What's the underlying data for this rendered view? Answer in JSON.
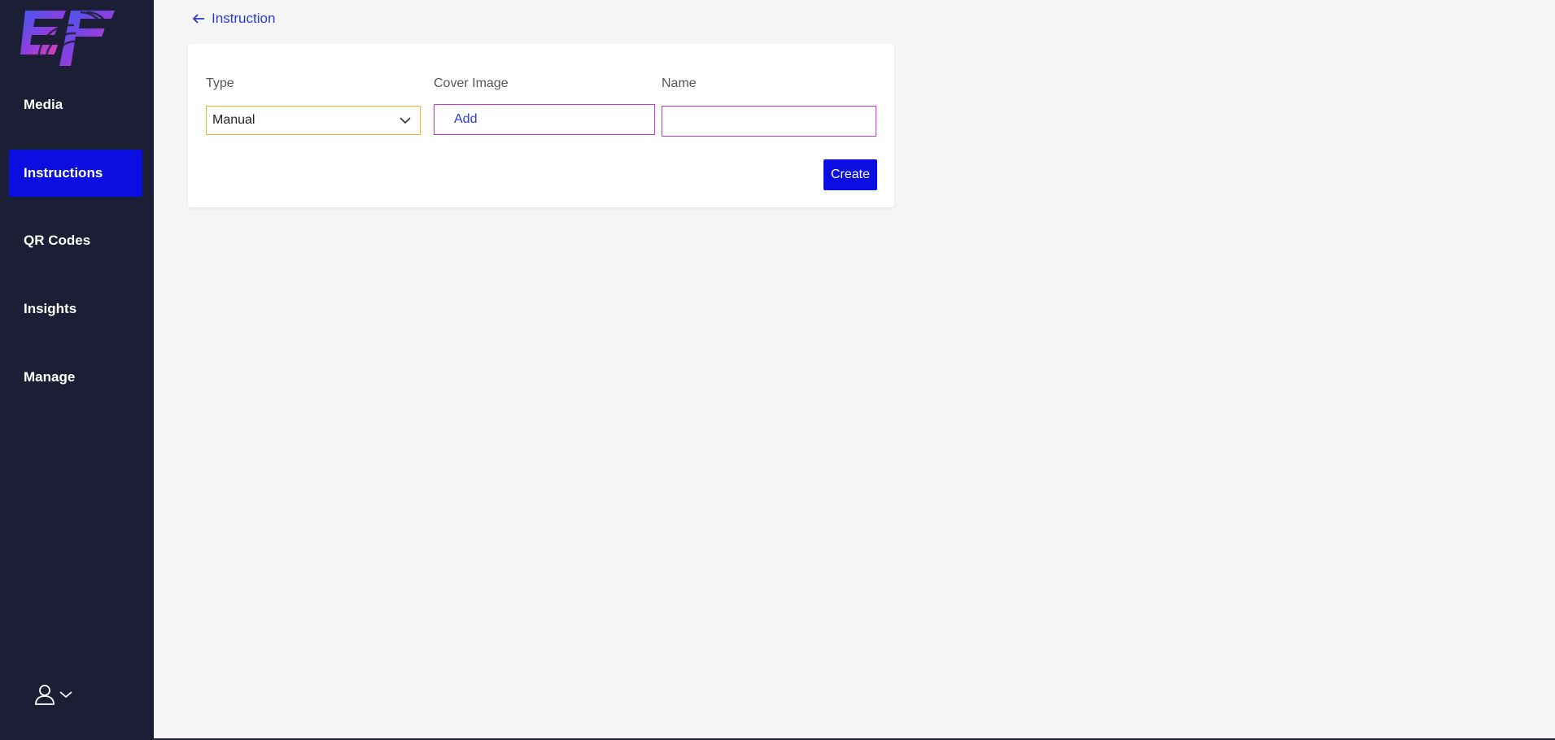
{
  "sidebar": {
    "items": [
      {
        "label": "Media"
      },
      {
        "label": "Instructions"
      },
      {
        "label": "QR Codes"
      },
      {
        "label": "Insights"
      },
      {
        "label": "Manage"
      }
    ],
    "active_index": 1,
    "logo_icon": "ef-logo",
    "user_icon": "user-icon"
  },
  "header": {
    "back_label": "Instruction",
    "back_icon": "arrow-left-icon"
  },
  "form": {
    "type_label": "Type",
    "type_value": "Manual",
    "cover_label": "Cover Image",
    "cover_add_label": "Add",
    "name_label": "Name",
    "name_value": "",
    "create_label": "Create"
  },
  "colors": {
    "sidebar_bg": "#1b1e35",
    "accent": "#0a0ee0",
    "select_border": "#f0b429",
    "input_border": "#c837d8",
    "link": "#2a3bd6"
  }
}
